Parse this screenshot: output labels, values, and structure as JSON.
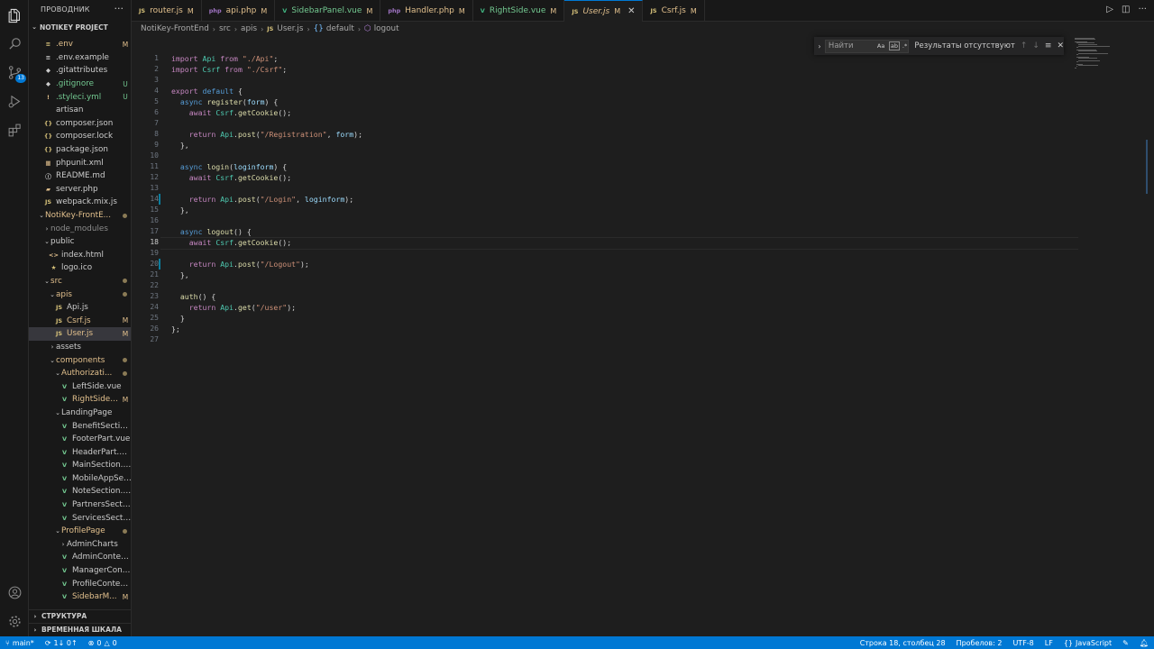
{
  "sidebar": {
    "title": "ПРОВОДНИК",
    "more": "···",
    "project": "NOTIKEY PROJECT",
    "items": [
      {
        "name": ".env",
        "icon": "≡",
        "mark": "M"
      },
      {
        "name": ".env.example",
        "icon": "≡",
        "mark": ""
      },
      {
        "name": ".gitattributes",
        "icon": "◆",
        "mark": ""
      },
      {
        "name": ".gitignore",
        "icon": "◆",
        "mark": "U"
      },
      {
        "name": ".styleci.yml",
        "icon": "!",
        "mark": "U"
      },
      {
        "name": "artisan",
        "icon": "",
        "mark": ""
      },
      {
        "name": "composer.json",
        "icon": "{}",
        "mark": ""
      },
      {
        "name": "composer.lock",
        "icon": "{}",
        "mark": ""
      },
      {
        "name": "package.json",
        "icon": "{}",
        "mark": ""
      },
      {
        "name": "phpunit.xml",
        "icon": "▦",
        "mark": ""
      },
      {
        "name": "README.md",
        "icon": "ⓘ",
        "mark": ""
      },
      {
        "name": "server.php",
        "icon": "▰",
        "mark": ""
      },
      {
        "name": "webpack.mix.js",
        "icon": "JS",
        "mark": ""
      },
      {
        "name": "NotiKey-FrontE...",
        "icon": "",
        "mark": ""
      },
      {
        "name": "node_modules",
        "icon": "",
        "mark": ""
      },
      {
        "name": "public",
        "icon": "",
        "mark": ""
      },
      {
        "name": "index.html",
        "icon": "<>",
        "mark": ""
      },
      {
        "name": "logo.ico",
        "icon": "★",
        "mark": ""
      },
      {
        "name": "src",
        "icon": "",
        "mark": ""
      },
      {
        "name": "apis",
        "icon": "",
        "mark": ""
      },
      {
        "name": "Api.js",
        "icon": "JS",
        "mark": ""
      },
      {
        "name": "Csrf.js",
        "icon": "JS",
        "mark": "M"
      },
      {
        "name": "User.js",
        "icon": "JS",
        "mark": "M"
      },
      {
        "name": "assets",
        "icon": "",
        "mark": ""
      },
      {
        "name": "components",
        "icon": "",
        "mark": ""
      },
      {
        "name": "Authorizati...",
        "icon": "",
        "mark": ""
      },
      {
        "name": "LeftSide.vue",
        "icon": "V",
        "mark": ""
      },
      {
        "name": "RightSide....",
        "icon": "V",
        "mark": "M"
      },
      {
        "name": "LandingPage",
        "icon": "",
        "mark": ""
      },
      {
        "name": "BenefitSection...",
        "icon": "V",
        "mark": ""
      },
      {
        "name": "FooterPart.vue",
        "icon": "V",
        "mark": ""
      },
      {
        "name": "HeaderPart.vue",
        "icon": "V",
        "mark": ""
      },
      {
        "name": "MainSection.vue",
        "icon": "V",
        "mark": ""
      },
      {
        "name": "MobileAppSect...",
        "icon": "V",
        "mark": ""
      },
      {
        "name": "NoteSection.vue",
        "icon": "V",
        "mark": ""
      },
      {
        "name": "PartnersSectio...",
        "icon": "V",
        "mark": ""
      },
      {
        "name": "ServicesSectio...",
        "icon": "V",
        "mark": ""
      },
      {
        "name": "ProfilePage",
        "icon": "",
        "mark": ""
      },
      {
        "name": "AdminCharts",
        "icon": "",
        "mark": ""
      },
      {
        "name": "AdminContent....",
        "icon": "V",
        "mark": ""
      },
      {
        "name": "ManagerConte...",
        "icon": "V",
        "mark": ""
      },
      {
        "name": "ProfileContent....",
        "icon": "V",
        "mark": ""
      },
      {
        "name": "SidebarM...",
        "icon": "V",
        "mark": "M"
      }
    ],
    "outline": "СТРУКТУРА",
    "timeline": "ВРЕМЕННАЯ ШКАЛА"
  },
  "activity": {
    "scm_badge": "13"
  },
  "tabs": [
    {
      "label": "router.js",
      "icon": "JS",
      "mark": "M",
      "kind": "js"
    },
    {
      "label": "api.php",
      "icon": "php",
      "mark": "M",
      "kind": "php"
    },
    {
      "label": "SidebarPanel.vue",
      "icon": "V",
      "mark": "M",
      "kind": "vue"
    },
    {
      "label": "Handler.php",
      "icon": "php",
      "mark": "M",
      "kind": "php"
    },
    {
      "label": "RightSide.vue",
      "icon": "V",
      "mark": "M",
      "kind": "vue"
    },
    {
      "label": "User.js",
      "icon": "JS",
      "mark": "M",
      "kind": "js",
      "active": true
    },
    {
      "label": "Csrf.js",
      "icon": "JS",
      "mark": "M",
      "kind": "js"
    }
  ],
  "breadcrumb": [
    "NotiKey-FrontEnd",
    "src",
    "apis",
    "User.js",
    "default",
    "logout"
  ],
  "editor": {
    "current_line": 18,
    "lines": [
      "import Api from \"./Api\";",
      "import Csrf from \"./Csrf\";",
      "",
      "export default {",
      "  async register(form) {",
      "    await Csrf.getCookie();",
      "",
      "    return Api.post(\"/Registration\", form);",
      "  },",
      "",
      "  async login(loginform) {",
      "    await Csrf.getCookie();",
      "",
      "    return Api.post(\"/Login\", loginform);",
      "  },",
      "",
      "  async logout() {",
      "    await Csrf.getCookie();",
      "",
      "    return Api.post(\"/Logout\");",
      "  },",
      "",
      "  auth() {",
      "    return Api.get(\"/user\");",
      "  }",
      "};",
      ""
    ]
  },
  "find": {
    "placeholder": "Найти",
    "opt_case": "Aa",
    "opt_word": "ab",
    "opt_regex": ".*",
    "result": "Результаты отсутствуют"
  },
  "status": {
    "branch": "main*",
    "sync": "1↓ 0↑",
    "errors": "0",
    "warnings": "0",
    "position": "Строка 18, столбец 28",
    "spaces": "Пробелов: 2",
    "encoding": "UTF-8",
    "eol": "LF",
    "language": "JavaScript"
  }
}
